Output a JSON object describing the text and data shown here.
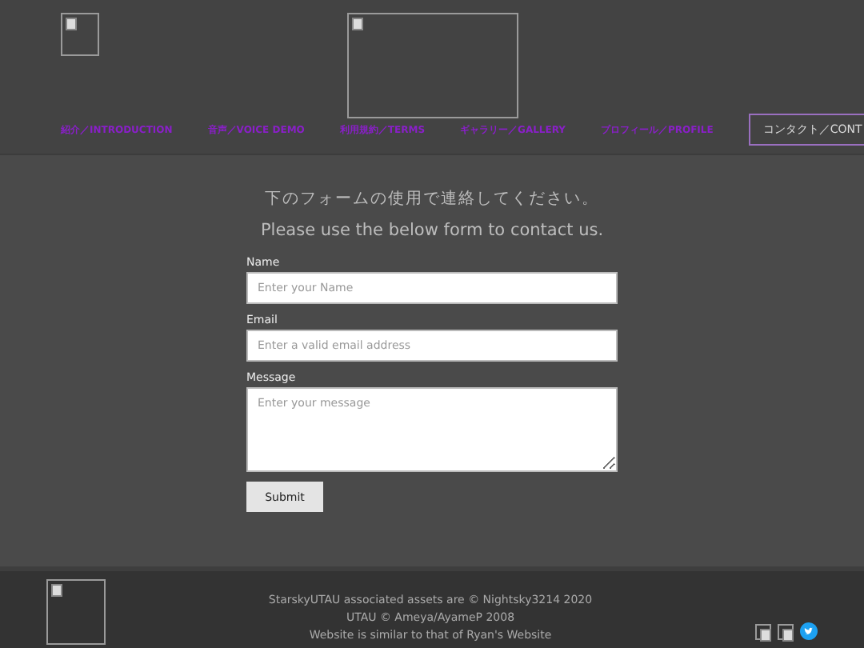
{
  "nav": [
    {
      "label": "紹介／INTRODUCTION",
      "selected": false
    },
    {
      "label": "音声／VOICE DEMO",
      "selected": false
    },
    {
      "label": "利用規約／TERMS",
      "selected": false
    },
    {
      "label": "ギャラリー／GALLERY",
      "selected": false
    },
    {
      "label": "プロフィール／PROFILE",
      "selected": false
    },
    {
      "label": "コンタクト／CONT",
      "selected": true
    }
  ],
  "intro": {
    "japanese": "下のフォームの使用で連絡してください。",
    "english": "Please use the below form to contact us."
  },
  "form": {
    "fields": [
      {
        "label": "Name",
        "placeholder": "Enter your Name",
        "kind": "input"
      },
      {
        "label": "Email",
        "placeholder": "Enter a valid email address",
        "kind": "input"
      },
      {
        "label": "Message",
        "placeholder": "Enter your message",
        "kind": "textarea"
      }
    ],
    "submit": "Submit"
  },
  "footer": {
    "lines": [
      "StarskyUTAU associated assets are © Nightsky3214 2020",
      "UTAU © Ameya/AyameP 2008",
      "Website is similar to that of Ryan's Website"
    ]
  }
}
